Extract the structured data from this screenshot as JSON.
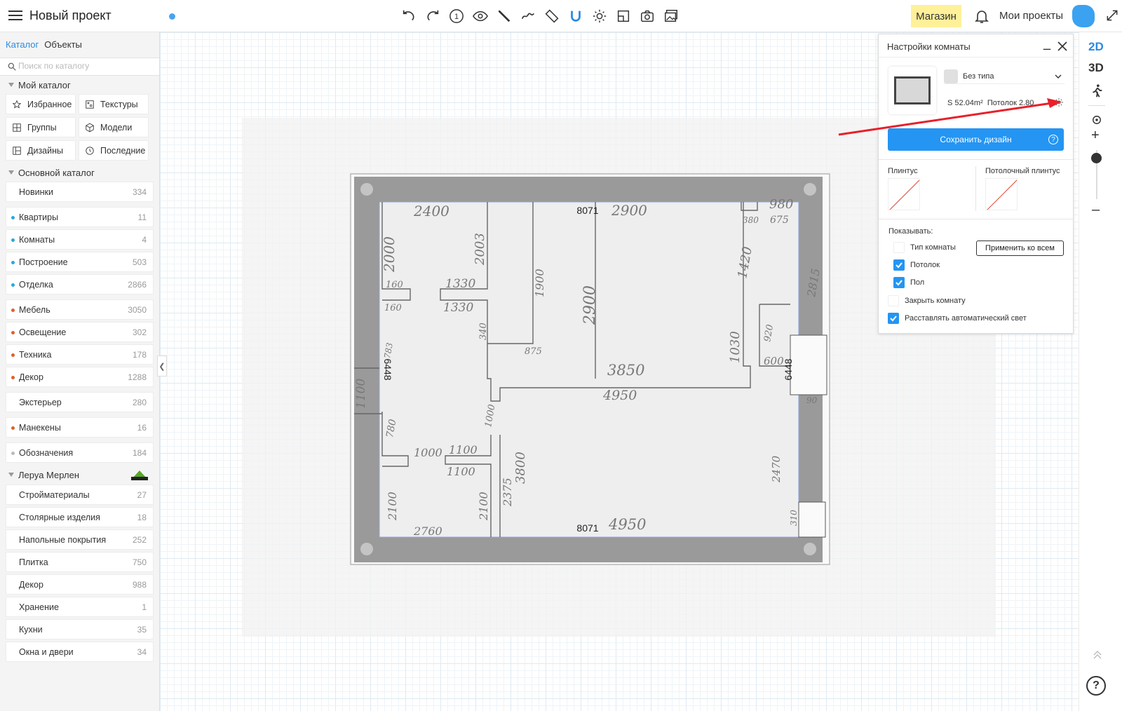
{
  "header": {
    "project_title": "Новый проект",
    "shop_label": "Магазин",
    "my_projects_label": "Мои проекты",
    "brand_colors": {
      "shop_bg": "#fff09a",
      "accent": "#2d8be0",
      "avatar": "#3aa2f0"
    }
  },
  "toolbar": {
    "icons": [
      "undo-icon",
      "redo-icon",
      "info-step-icon",
      "eye-icon",
      "pencil-icon",
      "wall-draw-icon",
      "ruler-icon",
      "magnet-icon",
      "sun-icon",
      "crop-icon",
      "camera-icon",
      "gallery-icon"
    ],
    "step_number": "1"
  },
  "sidebar": {
    "tabs": [
      "Каталог",
      "Объекты"
    ],
    "search_placeholder": "Поиск по каталогу",
    "my_catalog": {
      "title": "Мой каталог",
      "buttons": [
        "Избранное",
        "Текстуры",
        "Группы",
        "Модели",
        "Дизайны",
        "Последние"
      ]
    },
    "main_catalog": {
      "title": "Основной каталог",
      "items": [
        {
          "label": "Новинки",
          "count": "334",
          "dot": ""
        },
        {
          "label": "Квартиры",
          "count": "11",
          "dot": "#2aa8e0"
        },
        {
          "label": "Комнаты",
          "count": "4",
          "dot": "#2aa8e0"
        },
        {
          "label": "Построение",
          "count": "503",
          "dot": "#2aa8e0"
        },
        {
          "label": "Отделка",
          "count": "2866",
          "dot": "#2aa8e0"
        },
        {
          "label": "Мебель",
          "count": "3050",
          "dot": "#e0612a"
        },
        {
          "label": "Освещение",
          "count": "302",
          "dot": "#e0612a"
        },
        {
          "label": "Техника",
          "count": "178",
          "dot": "#e0612a"
        },
        {
          "label": "Декор",
          "count": "1288",
          "dot": "#e0612a"
        },
        {
          "label": "Экстерьер",
          "count": "280",
          "dot": ""
        },
        {
          "label": "Манекены",
          "count": "16",
          "dot": "#e0612a"
        },
        {
          "label": "Обозначения",
          "count": "184",
          "dot": "#bbbbbb"
        }
      ]
    },
    "leroy": {
      "title": "Леруа Мерлен",
      "items": [
        {
          "label": "Стройматериалы",
          "count": "27"
        },
        {
          "label": "Столярные изделия",
          "count": "18"
        },
        {
          "label": "Напольные покрытия",
          "count": "252"
        },
        {
          "label": "Плитка",
          "count": "750"
        },
        {
          "label": "Декор",
          "count": "988"
        },
        {
          "label": "Хранение",
          "count": "1"
        },
        {
          "label": "Кухни",
          "count": "35"
        },
        {
          "label": "Окна и двери",
          "count": "34"
        }
      ]
    }
  },
  "rail": {
    "mode_2d": "2D",
    "mode_3d": "3D",
    "help": "?",
    "plus": "+",
    "minus": "–"
  },
  "plan": {
    "top_dim": "8071",
    "bottom_dim": "8071",
    "left_dim": "6448",
    "right_dim": "6448",
    "sketch_numbers": [
      "2400",
      "2900",
      "980",
      "380",
      "675",
      "2000",
      "2003",
      "160",
      "1330",
      "160",
      "1330",
      "1900",
      "2900",
      "1420",
      "2815",
      "340",
      "875",
      "1030",
      "920",
      "600",
      "3850",
      "4950",
      "1100",
      "1000",
      "1100",
      "1000",
      "1100",
      "3800",
      "2375",
      "2100",
      "2100",
      "2760",
      "4950",
      "2470",
      "90",
      "310",
      "780",
      "783"
    ]
  },
  "panel": {
    "title": "Настройки комнаты",
    "room_type": "Без типа",
    "area_text": "S 52.04m²",
    "ceiling_text": "Потолок 2.80",
    "save_label": "Сохранить дизайн",
    "plinth_label": "Плинтус",
    "ceiling_plinth_label": "Потолочный плинтус",
    "show_label": "Показывать:",
    "apply_all_label": "Применить ко всем",
    "options": [
      {
        "label": "Тип комнаты",
        "checked": false
      },
      {
        "label": "Потолок",
        "checked": true
      },
      {
        "label": "Пол",
        "checked": true
      },
      {
        "label": "Закрыть комнату",
        "checked": false
      },
      {
        "label": "Расставлять автоматический свет",
        "checked": true
      }
    ]
  }
}
